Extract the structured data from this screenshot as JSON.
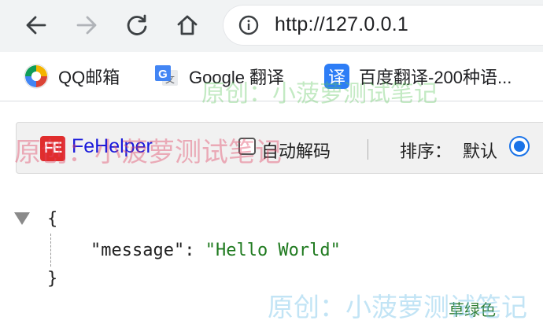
{
  "browser": {
    "nav": {
      "back_icon": "arrow-left-icon",
      "forward_icon": "arrow-right-icon",
      "reload_icon": "reload-icon",
      "home_icon": "home-icon"
    },
    "address_bar": {
      "info_icon": "info-icon",
      "url": "http://127.0.0.1"
    },
    "bookmarks": [
      {
        "label": "QQ邮箱",
        "icon": "qq-mail-icon"
      },
      {
        "label": "Google 翻译",
        "icon": "google-translate-icon"
      },
      {
        "label": "百度翻译-200种语...",
        "icon": "baidu-translate-icon",
        "icon_text": "译"
      }
    ]
  },
  "fehelper": {
    "logo_text": "FE",
    "title": "FeHelper",
    "auto_decode_label": "自动解码",
    "auto_decode_checked": false,
    "sort_label": "排序：",
    "sort_default_label": "默认",
    "sort_default_selected": true
  },
  "json_view": {
    "open_brace": "{",
    "close_brace": "}",
    "key": "\"message\"",
    "colon": ": ",
    "value": "\"Hello World\"",
    "theme_label": "草绿色"
  },
  "watermarks": [
    "原创：小菠萝测试笔记",
    "原创：小菠萝测试笔记",
    "原创：小菠萝测试笔记"
  ],
  "colors": {
    "chrome_bg": "#f1f3f4",
    "fehelper_title": "#1a1adb",
    "fehelper_logo": "#e02d2d",
    "json_string": "#1f7a1f",
    "radio_accent": "#1a73e8"
  }
}
